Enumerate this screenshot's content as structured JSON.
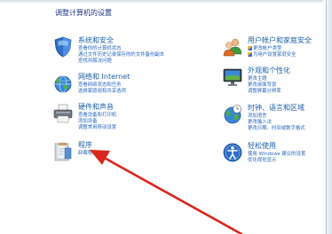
{
  "heading": "调整计算机的设置",
  "categories": [
    {
      "title": "系统和安全",
      "icon": "shield-icon",
      "links": [
        "查看你的计算机状态",
        "通过文件历史记录保存你的文件备份副本",
        "查找并解决问题"
      ]
    },
    {
      "title": "网络和 Internet",
      "icon": "network-globe-icon",
      "links": [
        "查看网络状态和任务",
        "选择家庭组和共享选项"
      ]
    },
    {
      "title": "硬件和声音",
      "icon": "printer-icon",
      "links": [
        "查看设备和打印机",
        "添加设备",
        "调整常用移动设置"
      ]
    },
    {
      "title": "程序",
      "icon": "programs-icon",
      "links": [
        "卸载程序"
      ]
    },
    {
      "title": "用户帐户和家庭安全",
      "icon": "users-icon",
      "links": [
        "更改帐户类型",
        "为用户设置家庭安全"
      ]
    },
    {
      "title": "外观和个性化",
      "icon": "display-icon",
      "links": [
        "更改主题",
        "更改桌面背景",
        "调整屏幕分辨率"
      ]
    },
    {
      "title": "时钟、语言和区域",
      "icon": "clock-globe-icon",
      "links": [
        "添加语言",
        "更改输入法",
        "更改日期、时间或数字格式"
      ]
    },
    {
      "title": "轻松使用",
      "icon": "ease-of-access-icon",
      "links": [
        "使用 Windows 建议的设置",
        "优化视觉显示"
      ]
    }
  ],
  "annotation_color": "#d9261c"
}
